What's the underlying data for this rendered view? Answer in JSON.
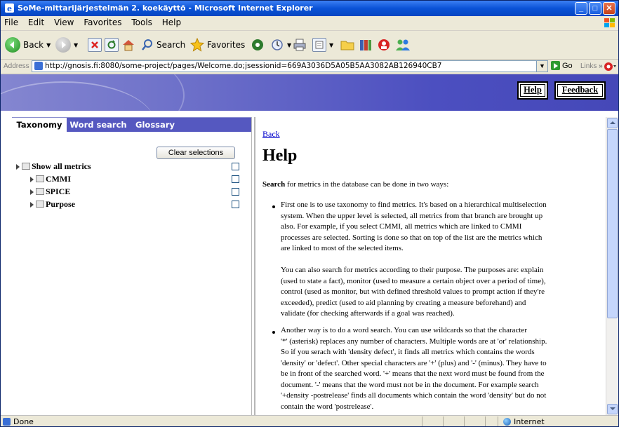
{
  "window": {
    "title": "SoMe-mittarijärjestelmän 2. koekäyttö - Microsoft Internet Explorer",
    "controls": {
      "minimize": "_",
      "maximize": "□",
      "close": "✕"
    }
  },
  "menubar": [
    "File",
    "Edit",
    "View",
    "Favorites",
    "Tools",
    "Help"
  ],
  "toolbar": {
    "back_label": "Back",
    "search_label": "Search",
    "favorites_label": "Favorites"
  },
  "addressbar": {
    "label": "Address",
    "url": "http://gnosis.fi:8080/some-project/pages/Welcome.do;jsessionid=669A3036D5A05B5AA3082AB126940CB7",
    "go_label": "Go",
    "links_label": "Links",
    "links_chevron": "»"
  },
  "header_nav": {
    "help": "Help",
    "feedback": "Feedback"
  },
  "left_panel": {
    "tabs": [
      "Taxonomy",
      "Word search",
      "Glossary"
    ],
    "clear_button": "Clear selections",
    "tree": {
      "root": "Show all metrics",
      "children": [
        "CMMI",
        "SPICE",
        "Purpose"
      ]
    }
  },
  "content": {
    "back_link": "Back",
    "heading": "Help",
    "intro_bold": "Search",
    "intro_rest": " for metrics in the database can be done in two ways:",
    "bullet1_lines": [
      "First one is to use taxonomy to find metrics. It's based on a hierarchical multiselection",
      "system. When the upper level is selected, all metrics from that branch are brought up",
      "also. For example, if you select CMMI, all metrics which are linked to CMMI",
      "processes are selected. Sorting is done so that on top of the list are the metrics which",
      "are linked to most of the selected items."
    ],
    "bullet1_para2_lines": [
      "You can also search for metrics according to their purpose. The purposes are: explain",
      "(used to state a fact), monitor (used to measure a certain object over a period of time),",
      "control (used as monitor, but with defined threshold values to prompt action if they're",
      "exceeded), predict (used to aid planning by creating a measure beforehand) and",
      "validate (for checking afterwards if a goal was reached)."
    ],
    "bullet2_lines": [
      "Another way is to do a word search. You can use wildcards so that the character",
      "'*' (asterisk) replaces any number of characters. Multiple words are at 'or' relationship.",
      "So if you serach with 'density defect', it finds all metrics which contains the words",
      "'density' or 'defect'. Other special characters are '+' (plus) and '-' (minus). They have to",
      "be in front of the searched word. '+' means that the next word must be found from the",
      "document. '-' means that the word must not be in the document. For example search",
      "'+density -postrelease' finds all documents which contain the word 'density' but do not",
      "contain the word 'postrelease'."
    ]
  },
  "statusbar": {
    "status": "Done",
    "zone": "Internet"
  },
  "colors": {
    "titlebar": "#0a52d6",
    "banner": "#5558c0",
    "tab_bar": "#5558c0",
    "link": "#0000cc"
  }
}
